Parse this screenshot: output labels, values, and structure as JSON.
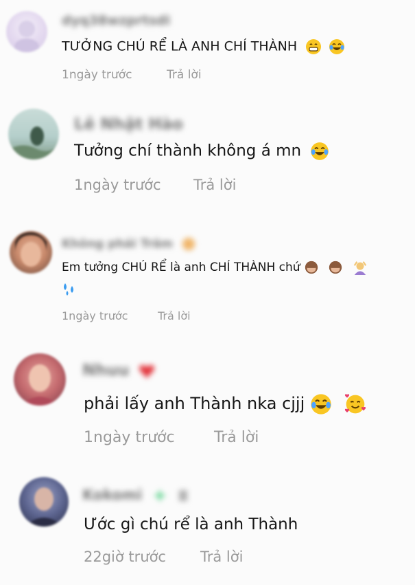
{
  "comments": [
    {
      "username": "dyq38wzprtsdi",
      "text": "TƯỞNG CHÚ RỂ LÀ ANH CHÍ THÀNH",
      "time": "1ngày trước",
      "reply": "Trả lời"
    },
    {
      "username": "Lê Nhật Hào",
      "text": "Tưởng chí thành không á mn",
      "time": "1ngày trước",
      "reply": "Trả lời"
    },
    {
      "username": "Không phải Trâm",
      "text": "Em tưởng CHÚ RỂ là anh CHÍ THÀNH chứ",
      "time": "1ngày trước",
      "reply": "Trả lời"
    },
    {
      "username": "Nhuu",
      "text": "phải lấy anh Thành nka cjjj",
      "time": "1ngày trước",
      "reply": "Trả lời"
    },
    {
      "username": "Kokomi",
      "text": "Ước gì chú rể là anh Thành",
      "time": "22giờ trước",
      "reply": "Trả lời"
    }
  ]
}
